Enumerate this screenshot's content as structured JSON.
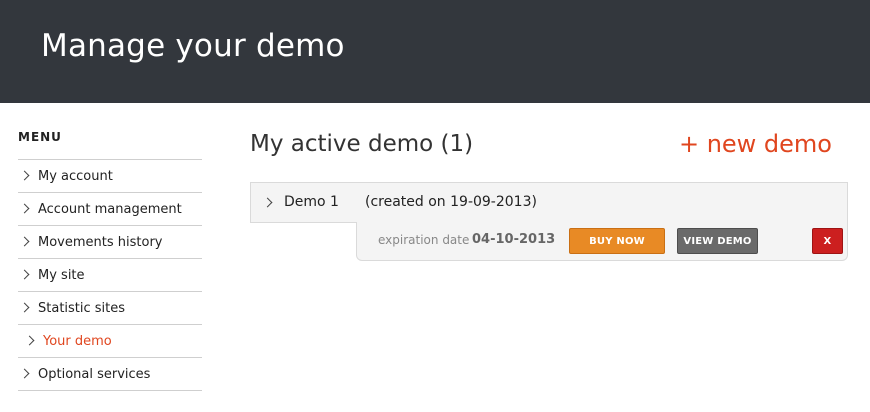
{
  "header": {
    "title": "Manage your demo"
  },
  "sidebar": {
    "heading": "MENU",
    "items": [
      {
        "label": "My account"
      },
      {
        "label": "Account management"
      },
      {
        "label": "Movements history"
      },
      {
        "label": "My site"
      },
      {
        "label": "Statistic sites"
      },
      {
        "label": "Your demo",
        "active": true
      },
      {
        "label": "Optional services"
      }
    ]
  },
  "main": {
    "title": "My active demo (1)",
    "new_demo_link": "+ new demo",
    "demos": [
      {
        "name": "Demo 1",
        "created": "(created on 19-09-2013)",
        "expiration_label": "expiration date",
        "expiration_value": "04-10-2013",
        "buy_label": "BUY NOW",
        "view_label": "VIEW DEMO",
        "delete_label": "X"
      }
    ]
  },
  "colors": {
    "header_bg": "#33373d",
    "accent": "#e0461f",
    "buy_button": "#e88a25",
    "view_button": "#6a6a6a",
    "delete_button": "#cc1f1f"
  }
}
